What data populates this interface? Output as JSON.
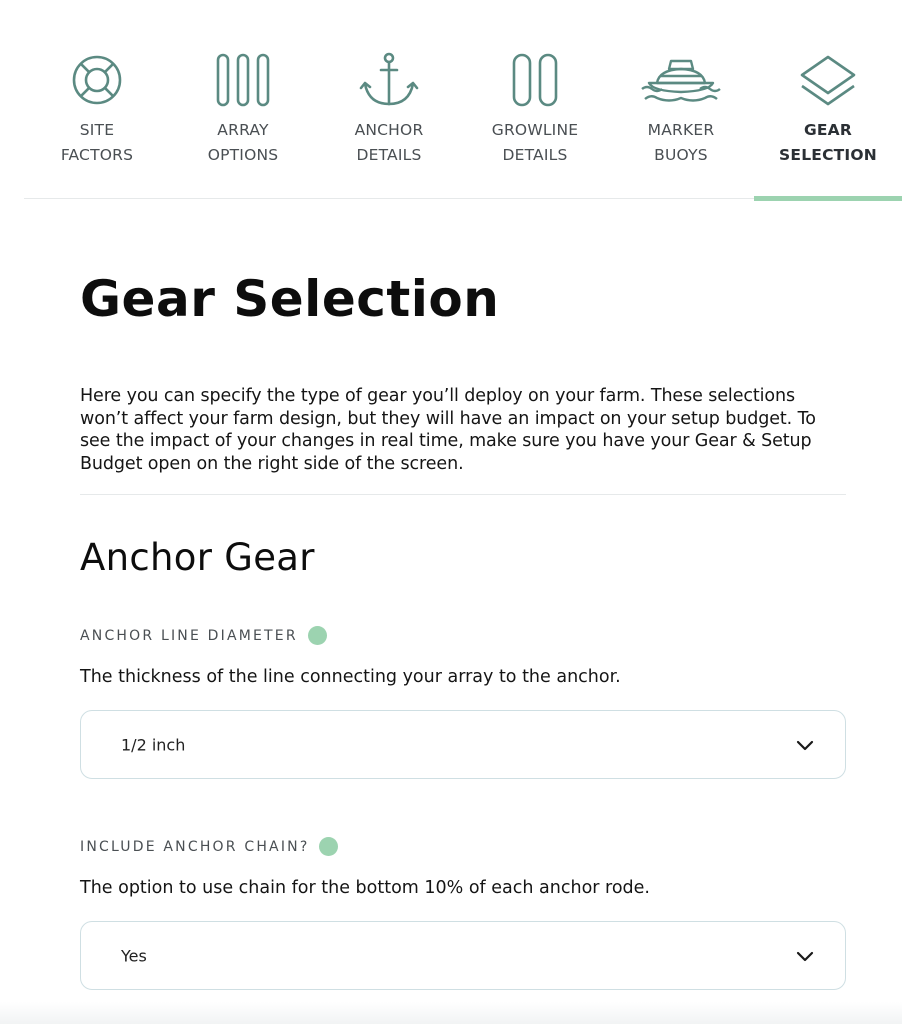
{
  "tabs": [
    {
      "icon": "lifebuoy-icon",
      "line1": "SITE",
      "line2": "FACTORS",
      "active": false
    },
    {
      "icon": "array-icon",
      "line1": "ARRAY",
      "line2": "OPTIONS",
      "active": false
    },
    {
      "icon": "anchor-icon",
      "line1": "ANCHOR",
      "line2": "DETAILS",
      "active": false
    },
    {
      "icon": "growline-icon",
      "line1": "GROWLINE",
      "line2": "DETAILS",
      "active": false
    },
    {
      "icon": "buoy-icon",
      "line1": "MARKER",
      "line2": "BUOYS",
      "active": false
    },
    {
      "icon": "layers-icon",
      "line1": "GEAR",
      "line2": "SELECTION",
      "active": true
    }
  ],
  "page": {
    "title": "Gear Selection",
    "intro": "Here you can specify the type of gear you’ll deploy on your farm. These selections won’t affect your farm design, but they will have an impact on your setup budget. To see the impact of your changes in real time, make sure you have your Gear & Setup Budget open on the right side of the screen."
  },
  "section": {
    "title": "Anchor Gear",
    "fields": [
      {
        "label": "ANCHOR LINE DIAMETER",
        "description": "The thickness of the line connecting your array to the anchor.",
        "value": "1/2 inch"
      },
      {
        "label": "INCLUDE ANCHOR CHAIN?",
        "description": "The option to use chain for the bottom 10% of each anchor rode.",
        "value": "Yes"
      }
    ]
  },
  "colors": {
    "icon": "#5b8a82",
    "accent": "#9cd3b0",
    "border": "#cfdfe3"
  }
}
